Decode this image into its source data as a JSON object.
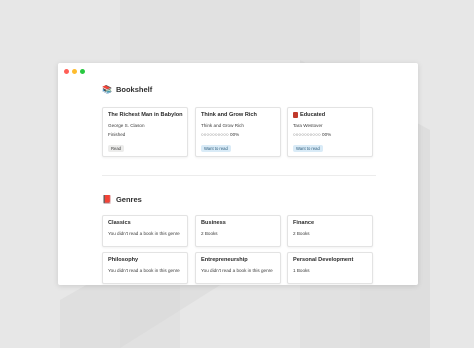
{
  "window": {
    "traffic_lights": [
      "#ff5f57",
      "#febc2e",
      "#28c840"
    ]
  },
  "bookshelf": {
    "title": "Bookshelf",
    "icon": "books-emoji",
    "cards": [
      {
        "title": "The Richest Man in Babylon",
        "line1": "George S. Clason",
        "line2": "Finished",
        "badge": "Read",
        "badge_style": "read"
      },
      {
        "title": "Think and Grow Rich",
        "line1": "Think and Grow Rich",
        "progress_text": "○○○○○○○○○○ 00%",
        "badge": "Want to read",
        "badge_style": "want"
      },
      {
        "title": "Educated",
        "title_icon": "red-book-icon",
        "line1": "Tara Westover",
        "progress_text": "○○○○○○○○○○ 00%",
        "badge": "Want to read",
        "badge_style": "want"
      }
    ]
  },
  "genres": {
    "title": "Genres",
    "icon": "red-books-emoji",
    "cards": [
      {
        "title": "Classics",
        "subtitle": "You didn't read a book in this genre"
      },
      {
        "title": "Business",
        "subtitle": "2 Books"
      },
      {
        "title": "Finance",
        "subtitle": "2 Books"
      },
      {
        "title": "Philosophy",
        "subtitle": "You didn't read a book in this genre"
      },
      {
        "title": "Entrepreneurship",
        "subtitle": "You didn't read a book in this genre"
      },
      {
        "title": "Personal Development",
        "subtitle": "1 Books"
      }
    ]
  }
}
